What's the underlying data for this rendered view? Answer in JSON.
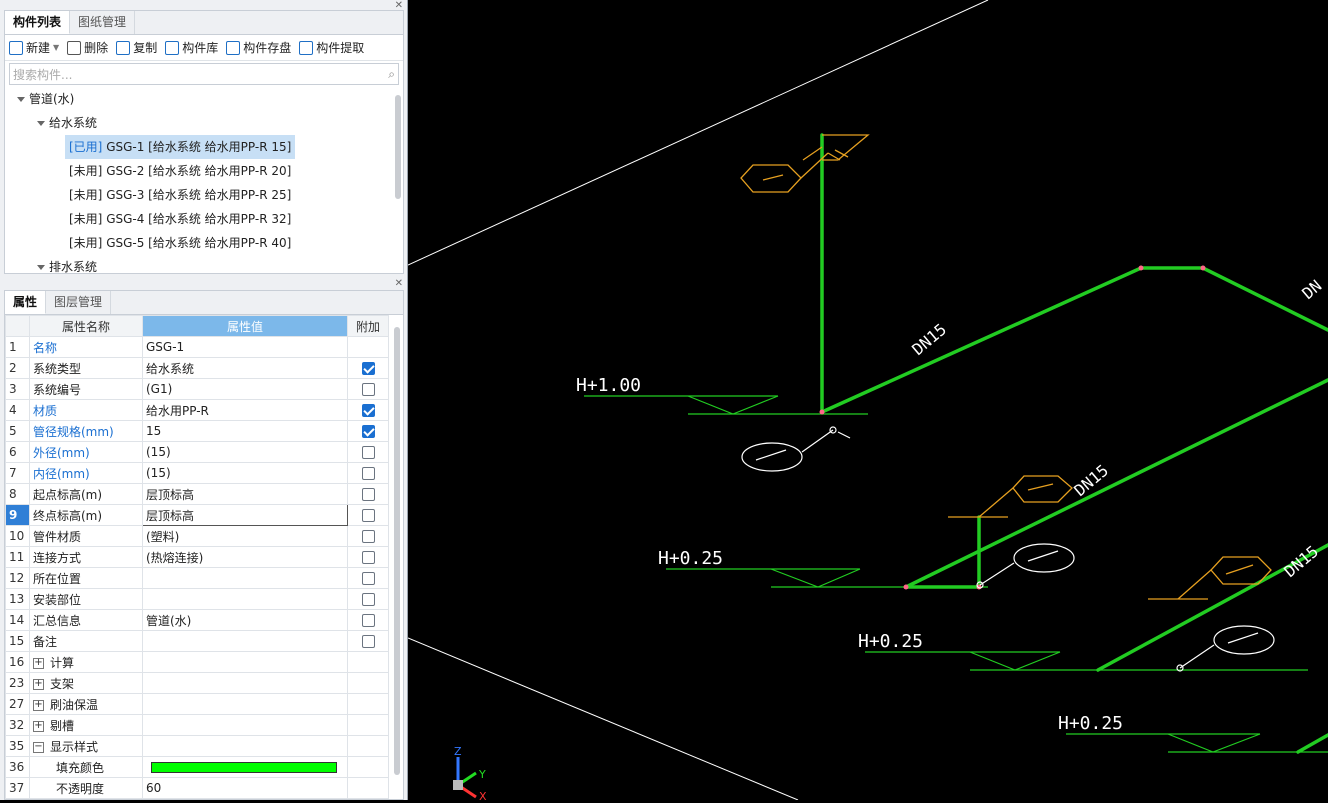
{
  "components": {
    "tabs": [
      "构件列表",
      "图纸管理"
    ],
    "toolbar": {
      "new": "新建",
      "delete": "删除",
      "copy": "复制",
      "library": "构件库",
      "save": "构件存盘",
      "extract": "构件提取"
    },
    "search_placeholder": "搜索构件...",
    "tree": {
      "root": "管道(水)",
      "group1": "给水系统",
      "items": [
        {
          "tag": "[已用]",
          "text": " GSG-1 [给水系统 给水用PP-R 15]"
        },
        {
          "tag": "[未用]",
          "text": " GSG-2 [给水系统 给水用PP-R 20]"
        },
        {
          "tag": "[未用]",
          "text": " GSG-3 [给水系统 给水用PP-R 25]"
        },
        {
          "tag": "[未用]",
          "text": " GSG-4 [给水系统 给水用PP-R 32]"
        },
        {
          "tag": "[未用]",
          "text": " GSG-5 [给水系统 给水用PP-R 40]"
        }
      ],
      "group2": "排水系统"
    }
  },
  "properties": {
    "tabs": [
      "属性",
      "图层管理"
    ],
    "headers": {
      "name": "属性名称",
      "value": "属性值",
      "extra": "附加"
    },
    "rows": [
      {
        "n": "1",
        "name": "名称",
        "value": "GSG-1",
        "blue": true,
        "cb": null
      },
      {
        "n": "2",
        "name": "系统类型",
        "value": "给水系统",
        "blue": false,
        "cb": true
      },
      {
        "n": "3",
        "name": "系统编号",
        "value": "(G1)",
        "blue": false,
        "cb": false
      },
      {
        "n": "4",
        "name": "材质",
        "value": "给水用PP-R",
        "blue": true,
        "cb": true
      },
      {
        "n": "5",
        "name": "管径规格(mm)",
        "value": "15",
        "blue": true,
        "cb": true
      },
      {
        "n": "6",
        "name": "外径(mm)",
        "value": "(15)",
        "blue": true,
        "cb": false
      },
      {
        "n": "7",
        "name": "内径(mm)",
        "value": "(15)",
        "blue": true,
        "cb": false
      },
      {
        "n": "8",
        "name": "起点标高(m)",
        "value": "层顶标高",
        "blue": false,
        "cb": false
      },
      {
        "n": "9",
        "name": "终点标高(m)",
        "value": "层顶标高",
        "blue": false,
        "cb": false,
        "current": true
      },
      {
        "n": "10",
        "name": "管件材质",
        "value": "(塑料)",
        "blue": false,
        "cb": false
      },
      {
        "n": "11",
        "name": "连接方式",
        "value": "(热熔连接)",
        "blue": false,
        "cb": false
      },
      {
        "n": "12",
        "name": "所在位置",
        "value": "",
        "blue": false,
        "cb": false
      },
      {
        "n": "13",
        "name": "安装部位",
        "value": "",
        "blue": false,
        "cb": false
      },
      {
        "n": "14",
        "name": "汇总信息",
        "value": "管道(水)",
        "blue": false,
        "cb": false
      },
      {
        "n": "15",
        "name": "备注",
        "value": "",
        "blue": false,
        "cb": false
      },
      {
        "n": "16",
        "name": "计算",
        "value": "",
        "group": "+"
      },
      {
        "n": "23",
        "name": "支架",
        "value": "",
        "group": "+"
      },
      {
        "n": "27",
        "name": "刷油保温",
        "value": "",
        "group": "+"
      },
      {
        "n": "32",
        "name": "剔槽",
        "value": "",
        "group": "+"
      },
      {
        "n": "35",
        "name": "显示样式",
        "value": "",
        "group": "−"
      },
      {
        "n": "36",
        "name": "填充颜色",
        "value": "",
        "child": true,
        "fill": "#00ff00"
      },
      {
        "n": "37",
        "name": "不透明度",
        "value": "60",
        "child": true
      }
    ]
  },
  "cad": {
    "labels": {
      "h1": "H+1.00",
      "h2": "H+0.25",
      "h3": "H+0.25",
      "h4": "H+0.25",
      "dn1": "DN15",
      "dn2": "DN15",
      "dn3": "DN15",
      "dn4": "DN"
    },
    "axes": {
      "z": "Z",
      "y": "Y",
      "x": "X"
    },
    "colors": {
      "pipe": "#22cc22",
      "marker": "#e6a020",
      "text": "#ffffff",
      "level": "#22cc22"
    }
  }
}
